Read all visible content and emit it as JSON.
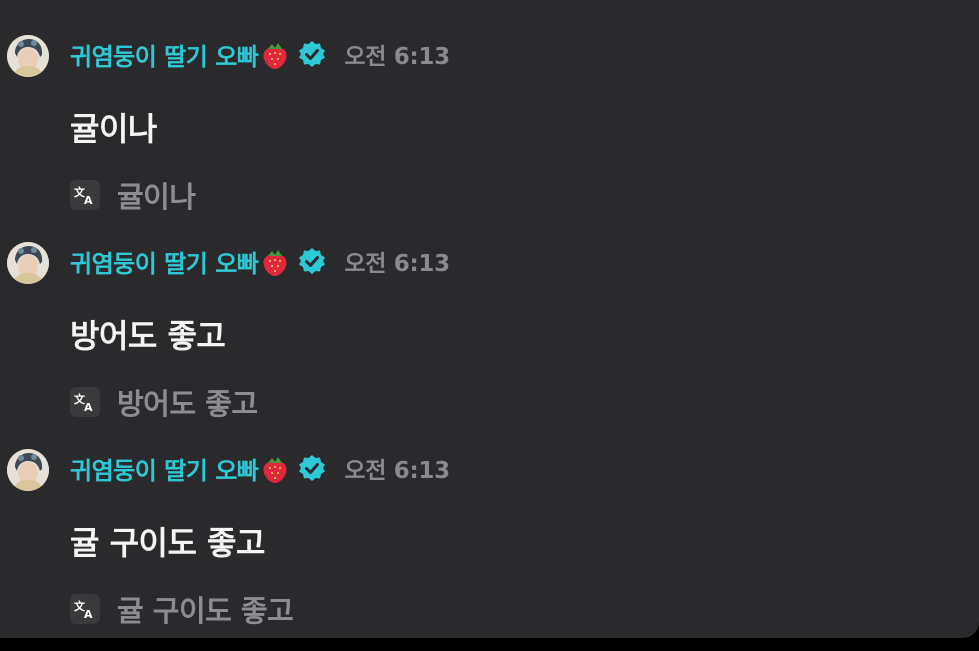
{
  "messages": [
    {
      "username": "귀염둥이 딸기 오빠",
      "timestamp": "오전 6:13",
      "text": "귤이나",
      "translation": "귤이나"
    },
    {
      "username": "귀염둥이 딸기 오빠",
      "timestamp": "오전 6:13",
      "text": "방어도 좋고",
      "translation": "방어도 좋고"
    },
    {
      "username": "귀염둥이 딸기 오빠",
      "timestamp": "오전 6:13",
      "text": "귤 구이도 좋고",
      "translation": "귤 구이도 좋고"
    }
  ],
  "icons": {
    "badge_emoji": "strawberry-icon",
    "verified": "verified-check-icon",
    "translate": "translate-icon"
  },
  "colors": {
    "background": "#2a2a2c",
    "username": "#2ec9d6",
    "verified_badge": "#2ec9d6",
    "message_text": "#f4f4f5",
    "muted_text": "#8a8a8e",
    "strawberry": "#e0283c"
  }
}
